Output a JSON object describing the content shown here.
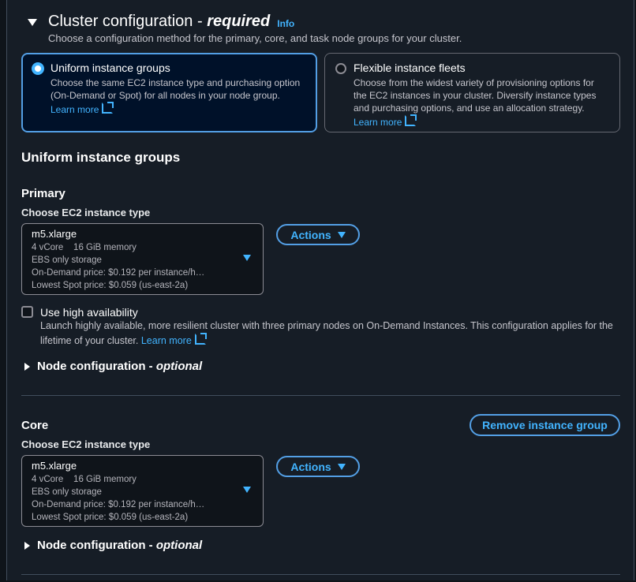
{
  "section": {
    "title": "Cluster configuration - ",
    "required": "required",
    "info": "Info",
    "subtitle": "Choose a configuration method for the primary, core, and task node groups for your cluster."
  },
  "tiles": [
    {
      "title": "Uniform instance groups",
      "desc1": "Choose the same EC2 instance type and purchasing option",
      "desc2": "(On-Demand or Spot) for all nodes in your node group.",
      "learn_more": "Learn more",
      "selected": true
    },
    {
      "title": "Flexible instance fleets",
      "desc1": "Choose from the widest variety of provisioning options for",
      "desc2": "the EC2 instances in your cluster. Diversify instance types",
      "desc3": "and purchasing options, and use an allocation strategy.",
      "learn_more": "Learn more",
      "selected": false
    }
  ],
  "uniform_heading": "Uniform instance groups",
  "primary": {
    "heading": "Primary",
    "choose_label": "Choose EC2 instance type",
    "instance": {
      "name": "m5.xlarge",
      "specs": "4 vCore    16 GiB memory",
      "storage": "EBS only storage",
      "ondemand": "On-Demand price: $0.192 per instance/h…",
      "spot": "Lowest Spot price: $0.059 (us-east-2a)"
    },
    "actions_label": "Actions",
    "high_availability": {
      "label": "Use high availability",
      "desc_line1": "Launch highly available, more resilient cluster with three primary nodes on On-Demand Instances. This configuration applies for the",
      "desc_line2": "lifetime of your cluster.",
      "learn_more": "Learn more",
      "checked": false
    },
    "node_config": "Node configuration - ",
    "optional": "optional"
  },
  "core": {
    "heading": "Core",
    "remove_label": "Remove instance group",
    "choose_label": "Choose EC2 instance type",
    "instance": {
      "name": "m5.xlarge",
      "specs": "4 vCore    16 GiB memory",
      "storage": "EBS only storage",
      "ondemand": "On-Demand price: $0.192 per instance/h…",
      "spot": "Lowest Spot price: $0.059 (us-east-2a)"
    },
    "actions_label": "Actions",
    "node_config": "Node configuration - ",
    "optional": "optional"
  },
  "colors": {
    "accent": "#42b4ff",
    "background": "#0f141a",
    "panel": "#161d26",
    "selected_tile": "#001129"
  }
}
